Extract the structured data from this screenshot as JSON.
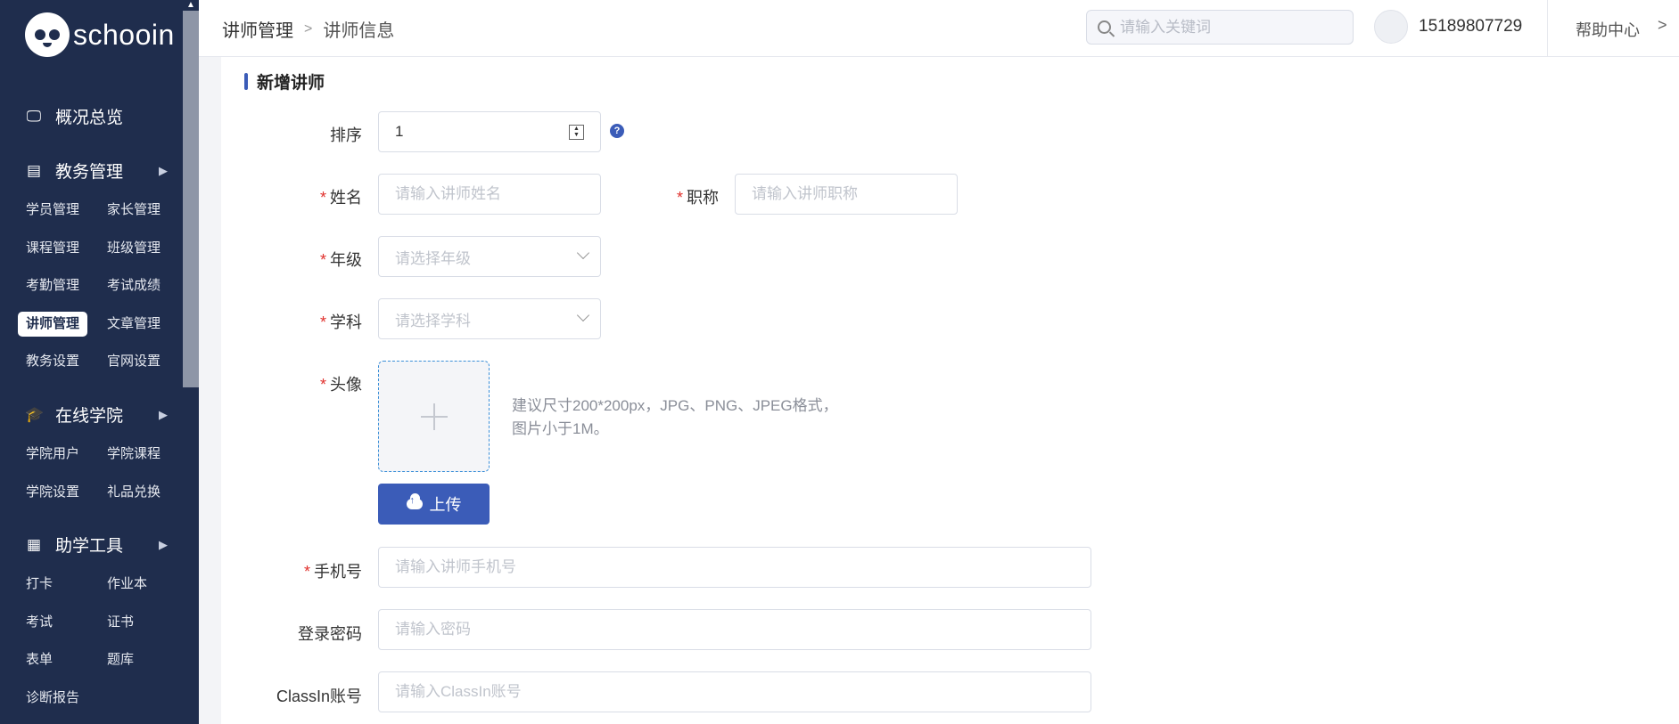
{
  "brand": {
    "name": "schooin"
  },
  "sidebar": {
    "sections": [
      {
        "label": "概况总览",
        "icon": "monitor-icon"
      },
      {
        "label": "教务管理",
        "icon": "book-icon",
        "items": [
          "学员管理",
          "家长管理",
          "课程管理",
          "班级管理",
          "考勤管理",
          "考试成绩",
          "讲师管理",
          "文章管理",
          "教务设置",
          "官网设置"
        ]
      },
      {
        "label": "在线学院",
        "icon": "graduation-cap-icon",
        "items": [
          "学院用户",
          "学院课程",
          "学院设置",
          "礼品兑换"
        ]
      },
      {
        "label": "助学工具",
        "icon": "grid-icon",
        "items": [
          "打卡",
          "作业本",
          "考试",
          "证书",
          "表单",
          "题库",
          "诊断报告"
        ]
      }
    ],
    "active_item": "讲师管理"
  },
  "header": {
    "breadcrumb": [
      "讲师管理",
      "讲师信息"
    ],
    "search_placeholder": "请输入关键词",
    "phone": "15189807729",
    "help": "帮助中心"
  },
  "form": {
    "title": "新增讲师",
    "sort": {
      "label": "排序",
      "value": "1"
    },
    "name": {
      "label": "姓名",
      "placeholder": "请输入讲师姓名"
    },
    "job_title": {
      "label": "职称",
      "placeholder": "请输入讲师职称"
    },
    "grade": {
      "label": "年级",
      "placeholder": "请选择年级"
    },
    "subject": {
      "label": "学科",
      "placeholder": "请选择学科"
    },
    "avatar": {
      "label": "头像",
      "hint_line1": "建议尺寸200*200px，JPG、PNG、JPEG格式，",
      "hint_line2": "图片小于1M。",
      "upload_label": "上传"
    },
    "mobile": {
      "label": "手机号",
      "placeholder": "请输入讲师手机号"
    },
    "password": {
      "label": "登录密码",
      "placeholder": "请输入密码"
    },
    "classin": {
      "label": "ClassIn账号",
      "placeholder": "请输入ClassIn账号"
    },
    "required_mark": "*"
  },
  "colors": {
    "sidebar_bg": "#1f2d4d",
    "accent": "#3b5cb8",
    "required": "#e0302c"
  }
}
